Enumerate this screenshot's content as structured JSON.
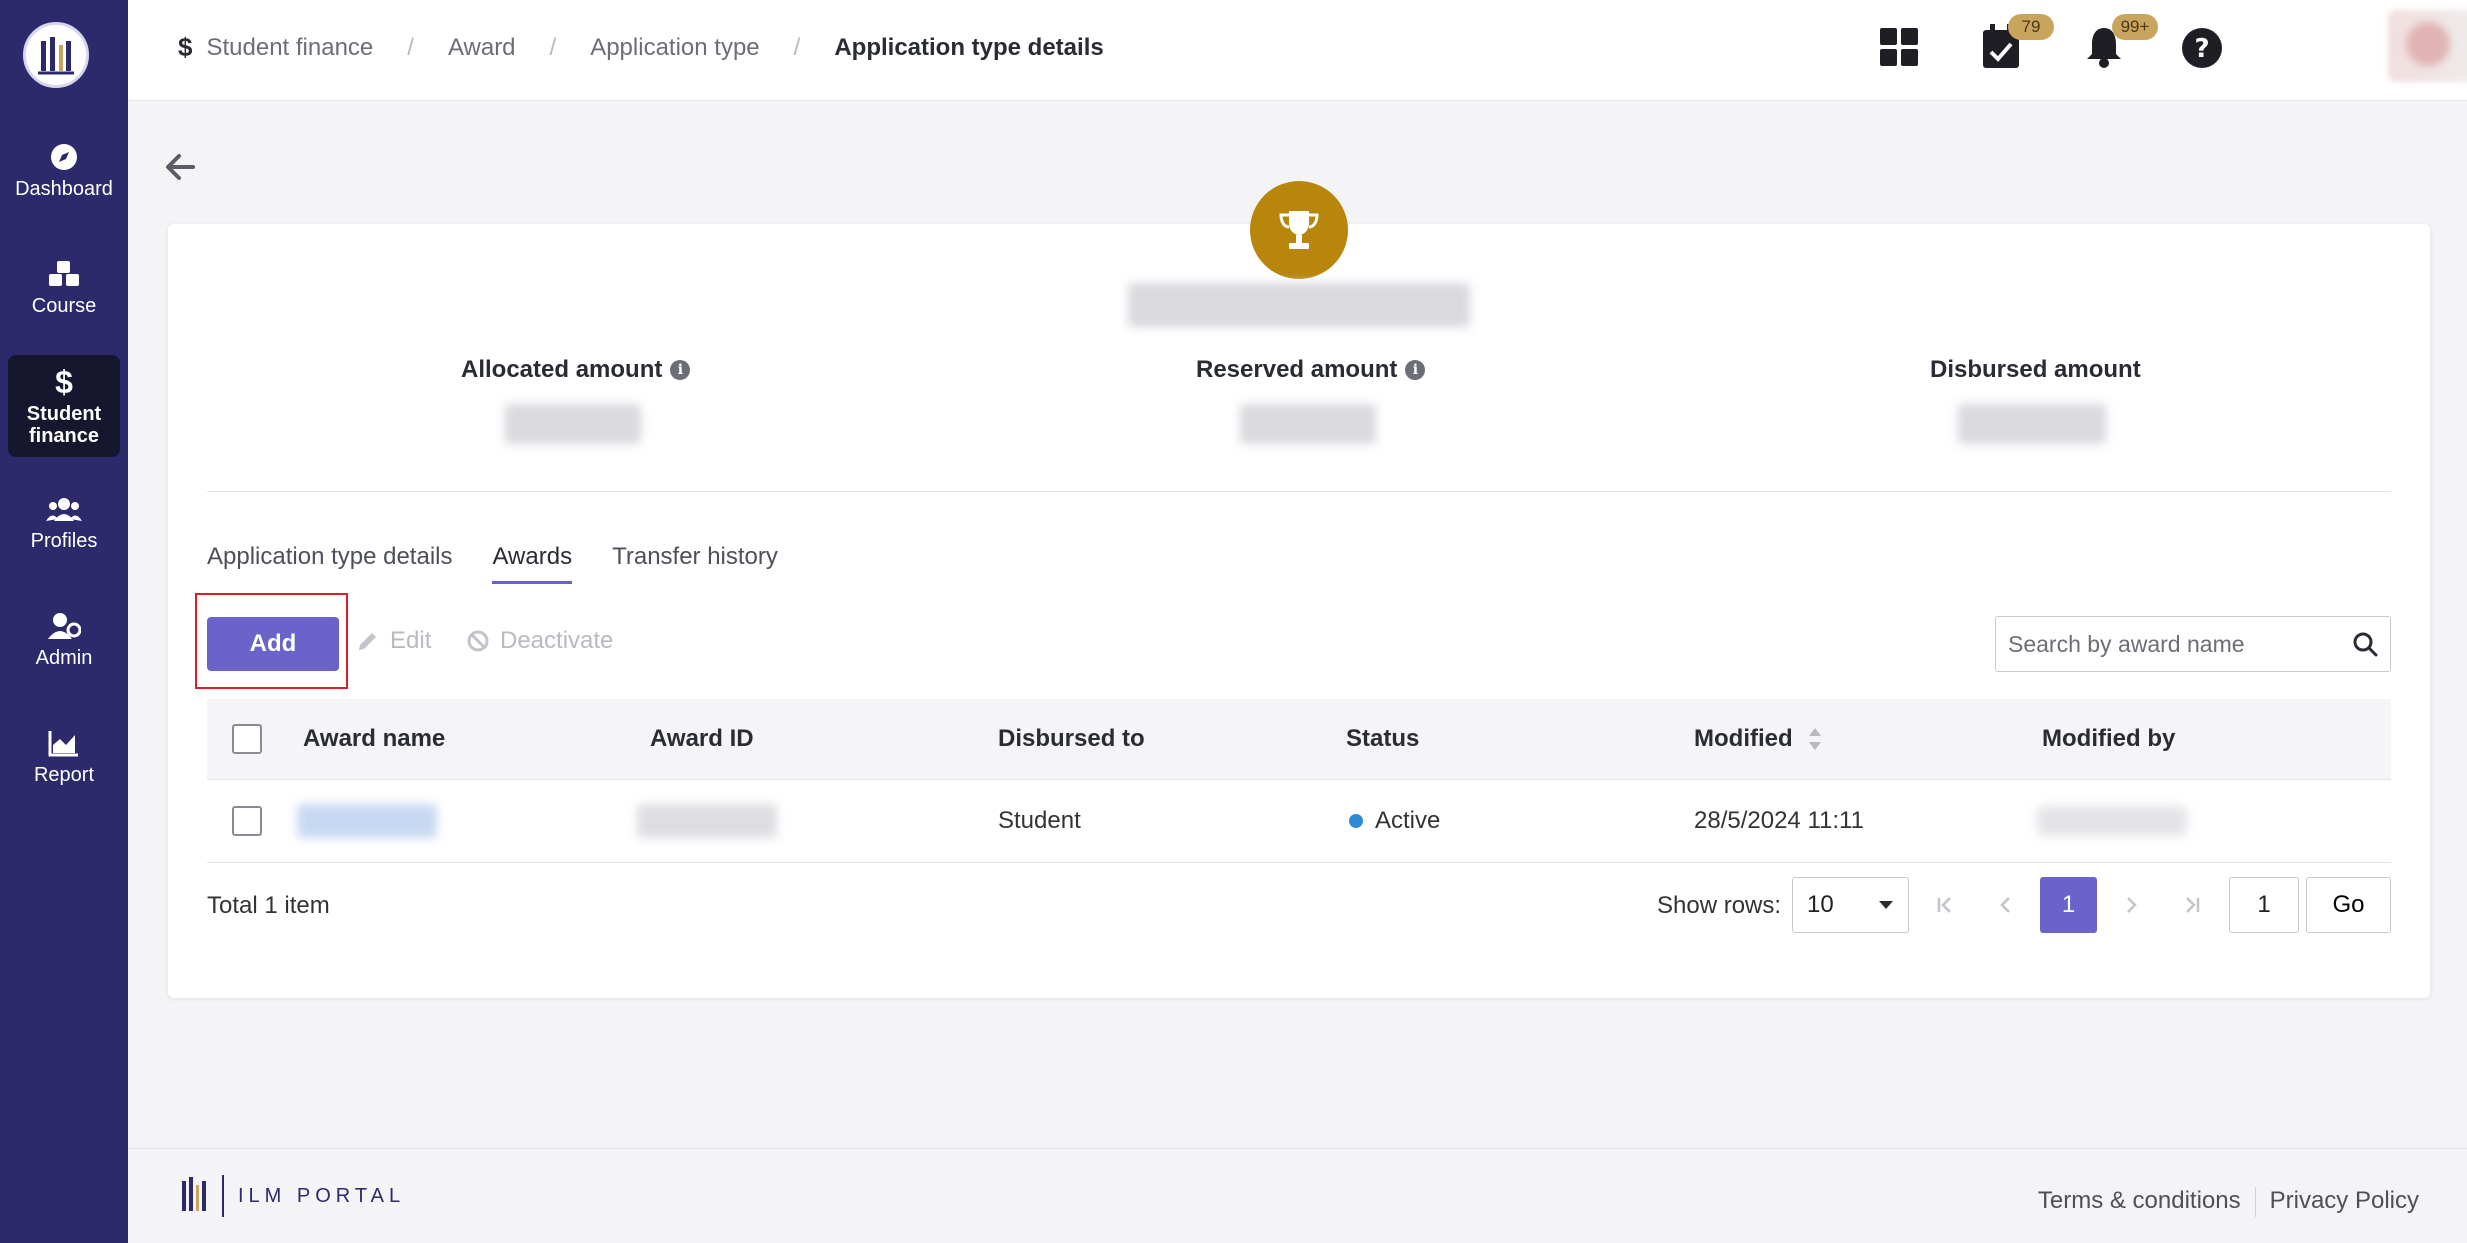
{
  "sidebar": {
    "items": [
      {
        "label": "Dashboard",
        "icon": "compass-icon"
      },
      {
        "label": "Course",
        "icon": "cubes-icon"
      },
      {
        "label": "Student finance",
        "icon": "dollar-icon",
        "active": true
      },
      {
        "label": "Profiles",
        "icon": "users-icon"
      },
      {
        "label": "Admin",
        "icon": "user-gear-icon"
      },
      {
        "label": "Report",
        "icon": "chart-area-icon"
      }
    ]
  },
  "breadcrumb": {
    "items": [
      "Student finance",
      "Award",
      "Application type"
    ],
    "current": "Application type details",
    "separator": "/"
  },
  "header": {
    "tasks_badge": "79",
    "notifications_badge": "99+"
  },
  "stats": {
    "allocated_label": "Allocated amount",
    "reserved_label": "Reserved amount",
    "disbursed_label": "Disbursed amount"
  },
  "tabs": [
    "Application type details",
    "Awards",
    "Transfer history"
  ],
  "toolbar": {
    "add_label": "Add",
    "edit_label": "Edit",
    "deactivate_label": "Deactivate",
    "search_placeholder": "Search by award name"
  },
  "table": {
    "columns": [
      "Award name",
      "Award ID",
      "Disbursed to",
      "Status",
      "Modified",
      "Modified by"
    ],
    "rows": [
      {
        "disbursed_to": "Student",
        "status": "Active",
        "modified": "28/5/2024 11:11"
      }
    ]
  },
  "pagination": {
    "total": "Total 1 item",
    "show_rows_label": "Show rows:",
    "rows_value": "10",
    "current_page": "1",
    "page_input": "1",
    "go_label": "Go"
  },
  "footer": {
    "brand": "ILM PORTAL",
    "terms": "Terms & conditions",
    "privacy": "Privacy Policy"
  },
  "colors": {
    "sidebar": "#2d2a6b",
    "primary": "#6b63c9",
    "trophy": "#b8860b",
    "badge": "#c9a45c",
    "status_active": "#2f8bd6",
    "highlight": "#e01b24"
  }
}
